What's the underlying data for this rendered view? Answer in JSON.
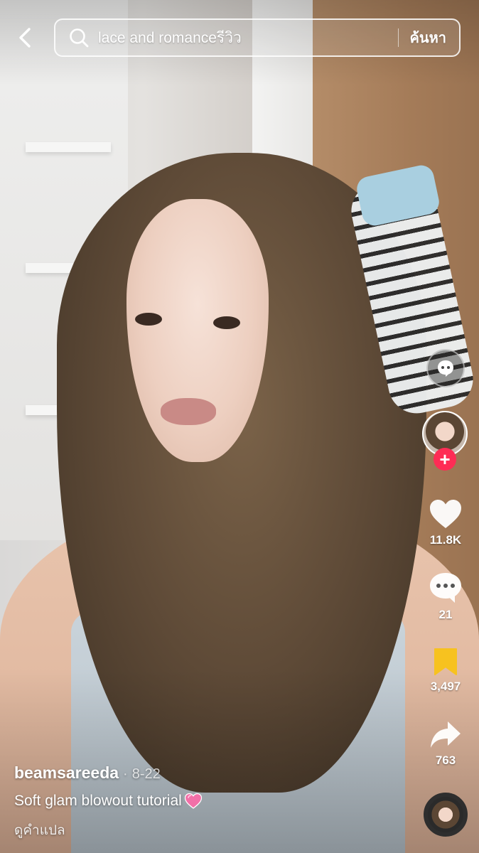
{
  "search": {
    "query": "lace and romanceรีวิว",
    "submit_label": "ค้นหา"
  },
  "actions": {
    "likes": "11.8K",
    "comments": "21",
    "saves": "3,497",
    "shares": "763"
  },
  "video": {
    "username": "beamsareeda",
    "separator": "·",
    "date": "8-22",
    "description": "Soft glam blowout tutorial",
    "translate_label": "ดูคำแปล"
  },
  "colors": {
    "follow_accent": "#fe2c55",
    "save_active": "#f7c21f",
    "icon": "#ffffff"
  },
  "icons": {
    "back": "chevron-left-icon",
    "search": "search-icon",
    "assistant": "ai-assistant-icon",
    "like": "heart-icon",
    "comment": "comment-bubble-icon",
    "save": "bookmark-icon",
    "share": "share-arrow-icon",
    "caption_emoji": "pink-heart-emoji"
  }
}
